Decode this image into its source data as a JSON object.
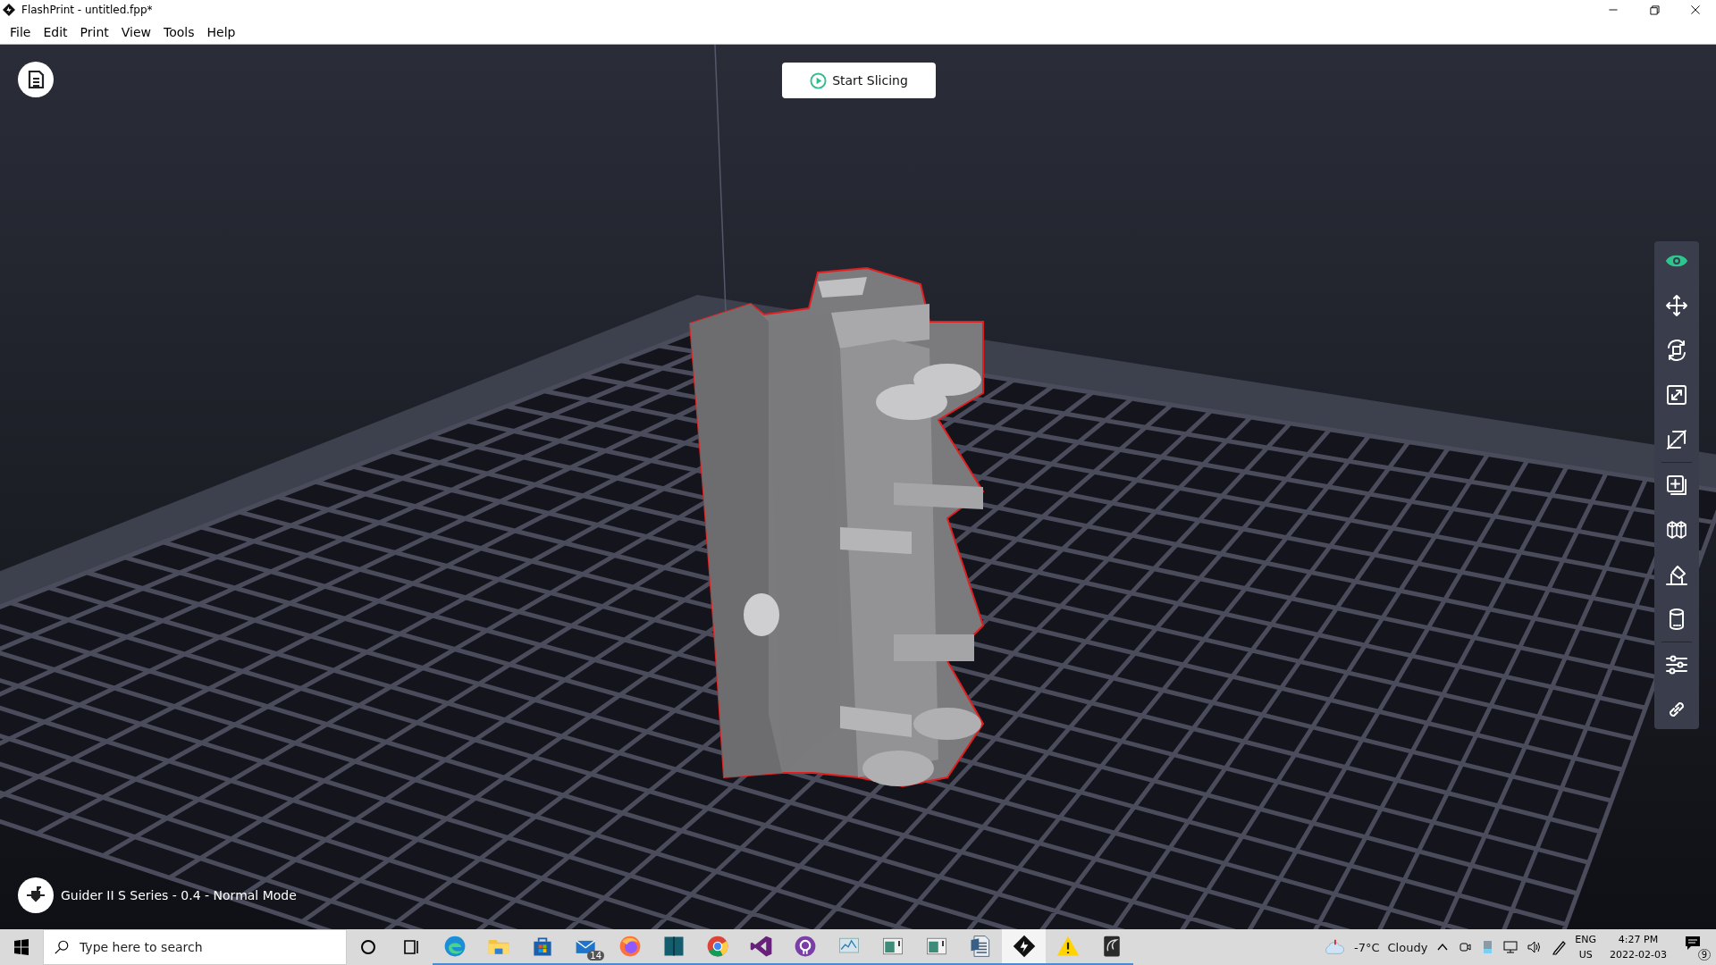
{
  "window": {
    "title": "FlashPrint - untitled.fpp*"
  },
  "menu": [
    "File",
    "Edit",
    "Print",
    "View",
    "Tools",
    "Help"
  ],
  "viewport": {
    "start_button": "Start Slicing",
    "machine_label": "Guider II S Series - 0.4 - Normal Mode",
    "tools": [
      {
        "kind": "view",
        "selected": true
      },
      {
        "kind": "move",
        "selected": false
      },
      {
        "kind": "rotate",
        "selected": false
      },
      {
        "kind": "scale",
        "selected": false
      },
      {
        "kind": "cut",
        "selected": false
      },
      {
        "kind": "add",
        "selected": false
      },
      {
        "kind": "supports",
        "selected": false
      },
      {
        "kind": "layflat",
        "selected": false
      },
      {
        "kind": "cylinder",
        "selected": false
      },
      {
        "kind": "settings",
        "selected": false
      },
      {
        "kind": "link",
        "selected": false
      }
    ]
  },
  "taskbar": {
    "search": {
      "placeholder": "Type here to search"
    },
    "apps": [
      {
        "kind": "edge",
        "selected": false
      },
      {
        "kind": "folder",
        "selected": false
      },
      {
        "kind": "store",
        "selected": false
      },
      {
        "kind": "mail",
        "selected": false,
        "badge": "14"
      },
      {
        "kind": "firefox",
        "selected": false
      },
      {
        "kind": "tealbook",
        "selected": false
      },
      {
        "kind": "chrome",
        "selected": false
      },
      {
        "kind": "vstudio",
        "selected": false
      },
      {
        "kind": "github",
        "selected": false
      },
      {
        "kind": "monitor",
        "selected": false
      },
      {
        "kind": "window",
        "selected": false
      },
      {
        "kind": "window",
        "selected": false
      },
      {
        "kind": "document",
        "selected": false
      },
      {
        "kind": "flashprint",
        "selected": true
      },
      {
        "kind": "warning",
        "selected": false
      },
      {
        "kind": "darkapp",
        "selected": false
      }
    ],
    "weather": {
      "temperature": "-7°C",
      "condition": "Cloudy"
    },
    "language": {
      "code": "ENG",
      "region": "US"
    },
    "clock": {
      "time": "4:27 PM",
      "date": "2022-02-03"
    },
    "notifications": "9"
  }
}
